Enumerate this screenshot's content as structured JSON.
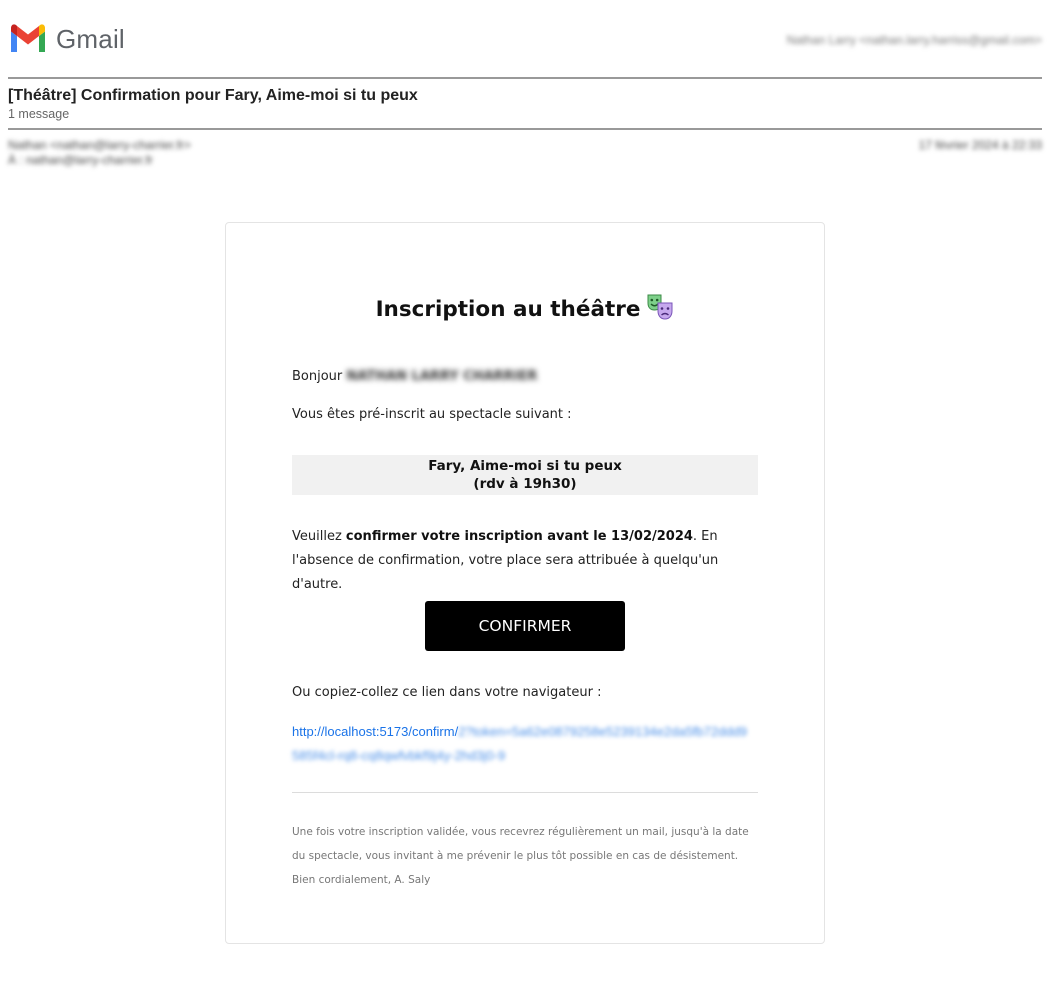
{
  "app": {
    "name": "Gmail",
    "logo_icon": "gmail-m-icon",
    "brand_colors": [
      "#EA4335",
      "#4285F4",
      "#34A853",
      "#FBBC05",
      "#C5221F"
    ]
  },
  "account": {
    "label": "Nathan Larry <nathan.larry.harriss@gmail.com>"
  },
  "email": {
    "subject": "[Théâtre] Confirmation pour Fary, Aime-moi si tu peux",
    "message_count": "1 message",
    "from": "Nathan <nathan@larry-charrier.fr>",
    "to": "À : nathan@larry-charrier.fr",
    "date": "17 février 2024 à 22:33"
  },
  "card": {
    "title": "Inscription au théâtre",
    "title_icon": "theater-masks-icon",
    "greeting_prefix": "Bonjour",
    "greeting_name": "NATHAN LARRY CHARRIER",
    "intro": "Vous êtes pré-inscrit au spectacle suivant :",
    "show_title": "Fary, Aime-moi si tu peux",
    "show_time": "(rdv à 19h30)",
    "notice_prefix": "Veuillez ",
    "notice_bold": "confirmer votre inscription avant le 13/02/2024",
    "notice_suffix": ". En l'absence de confirmation, votre place sera attribuée à quelqu'un d'autre.",
    "confirm_button": "CONFIRMER",
    "copy_label": "Ou copiez-collez ce lien dans votre navigateur :",
    "link_base": "http://localhost:5173/confirm/",
    "link_token": "2?token=5a62e0879258e5239134e2da5fb72ddd9585f4cl-rq8-cq8qwfvbkf9j4y-2hd3j0-9",
    "footer_line1": "Une fois votre inscription validée, vous recevrez régulièrement un mail, jusqu'à la date du spectacle, vous invitant à me prévenir le plus tôt possible en cas de désistement.",
    "footer_line2": "Bien cordialement, A. Saly"
  }
}
